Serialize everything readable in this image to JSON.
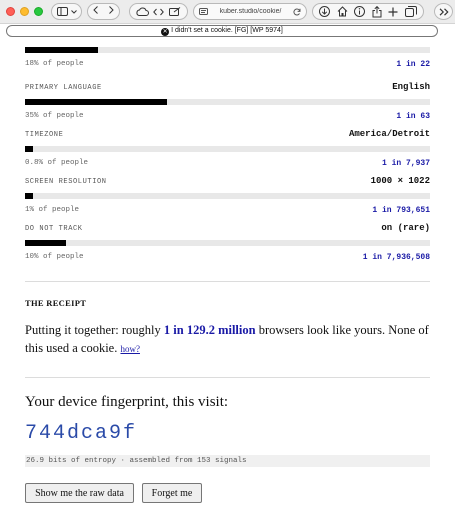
{
  "browser": {
    "url": "kuber.studio/cookie/",
    "banner": "I didn't set a cookie. [FG] [WP 5974]",
    "icons": [
      "sidebar-icon",
      "chevron-down-icon",
      "back-icon",
      "forward-icon",
      "cloud-icon",
      "code-icon",
      "note-icon",
      "reader-icon",
      "refresh-icon",
      "download-icon",
      "home-icon",
      "info-icon",
      "share-icon",
      "new-tab-icon",
      "tabs-icon",
      "more-icon"
    ]
  },
  "attributes": [
    {
      "label": "",
      "value": "",
      "fill": 0.18,
      "pct": "18% of people",
      "odds": "1 in 22"
    },
    {
      "label": "PRIMARY LANGUAGE",
      "value": "English",
      "fill": 0.35,
      "pct": "35% of people",
      "odds": "1 in 63"
    },
    {
      "label": "TIMEZONE",
      "value": "America/Detroit",
      "fill": 0.02,
      "pct": "0.8% of people",
      "odds": "1 in 7,937"
    },
    {
      "label": "SCREEN RESOLUTION",
      "value": "1000 × 1022",
      "fill": 0.02,
      "pct": "1% of people",
      "odds": "1 in 793,651"
    },
    {
      "label": "DO NOT TRACK",
      "value": "on (rare)",
      "fill": 0.1,
      "pct": "10% of people",
      "odds": "1 in 7,936,508"
    }
  ],
  "receipt": {
    "title": "THE RECEIPT",
    "text_before": "Putting it together: roughly ",
    "highlight": "1 in 129.2 million",
    "text_after": " browsers look like yours. None of this used a cookie. ",
    "link": "how?"
  },
  "fingerprint": {
    "title": "Your device fingerprint, this visit:",
    "hash": "744dca9f",
    "meta": "26.9 bits of entropy · assembled from 153 signals"
  },
  "buttons": {
    "raw": "Show me the raw data",
    "forget": "Forget me"
  },
  "colors": {
    "accent": "#1a1aa6",
    "hash": "#2a4aa8",
    "bar": "#000000",
    "track": "#e8e8e8"
  }
}
